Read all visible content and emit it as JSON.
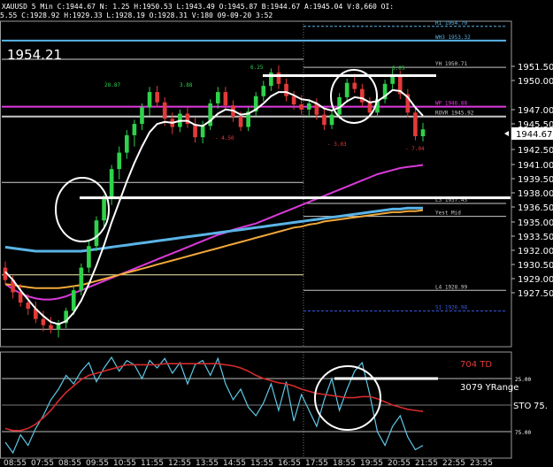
{
  "header": {
    "line1": "XAUUSD 5 Min  C:1944.67  N:  1.25  H:1950.53  L:1943.49  O:1945.87  B:1944.67  A:1945.04  V:8,660  OI:",
    "line2": "5.55  C:1928.92  H:1929.33  L:1928.19  O:1928.31  V:180  09-09-20  3:52",
    "big_price": "1954.21"
  },
  "colors": {
    "background": "#000000",
    "candle_up": "#2fd24a",
    "candle_down": "#e23a3a",
    "ema": "#ffffff",
    "pink_ma": "#d93ad9",
    "blue_ma": "#5ab4e6",
    "orange_ma": "#f2a93a",
    "magenta_level": "#e03ae0",
    "stoch_k": "#5ec8e6",
    "stoch_d": "#d42b2b"
  },
  "chart_data": [
    {
      "type": "candlestick",
      "title": "XAUUSD 5 Min",
      "y_ticks": [
        "1951.50",
        "1950.00",
        "1947.00",
        "1945.50",
        "1944.00",
        "1942.50",
        "1941.00",
        "1939.50",
        "1938.00",
        "1936.50",
        "1935.00",
        "1933.50",
        "1932.00",
        "1930.50",
        "1929.00",
        "1927.50"
      ],
      "ylim": [
        1923.5,
        1955.2
      ],
      "current_price": "1944.67",
      "levels": [
        {
          "label": "R1 1954.70",
          "value": 1954.7,
          "color": "#5ab4e6"
        },
        {
          "label": "WH3 1953.32",
          "value": 1953.32,
          "color": "#5ab4e6"
        },
        {
          "label": "YH 1950.71",
          "value": 1950.71,
          "color": "#c8c8c8"
        },
        {
          "label": "WP 1946.88",
          "value": 1946.88,
          "color": "#e03ae0"
        },
        {
          "label": "ROVR 1945.92",
          "value": 1945.92,
          "color": "#c8c8c8"
        },
        {
          "label": "L3 1937.45",
          "value": 1937.45,
          "color": "#c8c8c8"
        },
        {
          "label": "Yest Mid",
          "value": 1936.2,
          "color": "#c8c8c8"
        },
        {
          "label": "L4 1928.99",
          "value": 1928.99,
          "color": "#c8c8c8"
        },
        {
          "label": "S1 1926.98",
          "value": 1926.98,
          "color": "#3a5ae6"
        }
      ],
      "swing_labels": [
        {
          "text": "28.87",
          "color": "#2fd24a"
        },
        {
          "text": "3.88",
          "color": "#2fd24a"
        },
        {
          "text": "6.25",
          "color": "#2fd24a"
        },
        {
          "text": "6.05",
          "color": "#2fd24a"
        },
        {
          "text": "- 4.50",
          "color": "#e23a3a"
        },
        {
          "text": "- 3.03",
          "color": "#e23a3a"
        },
        {
          "text": "- 7.04",
          "color": "#e23a3a"
        }
      ],
      "candles": [
        [
          1931.2,
          1931.8,
          1929.6,
          1930.0
        ],
        [
          1930.0,
          1930.4,
          1928.2,
          1928.8
        ],
        [
          1928.8,
          1929.6,
          1927.4,
          1927.8
        ],
        [
          1927.8,
          1928.6,
          1926.6,
          1927.2
        ],
        [
          1927.2,
          1927.9,
          1925.8,
          1926.2
        ],
        [
          1926.2,
          1927.0,
          1925.0,
          1925.6
        ],
        [
          1925.6,
          1926.4,
          1924.8,
          1925.2
        ],
        [
          1925.2,
          1926.1,
          1924.4,
          1925.8
        ],
        [
          1925.8,
          1927.3,
          1925.3,
          1927.0
        ],
        [
          1927.0,
          1929.4,
          1926.6,
          1929.0
        ],
        [
          1929.0,
          1931.6,
          1928.5,
          1931.2
        ],
        [
          1931.2,
          1933.8,
          1930.7,
          1933.3
        ],
        [
          1933.3,
          1936.2,
          1932.8,
          1935.8
        ],
        [
          1935.8,
          1938.3,
          1935.2,
          1937.9
        ],
        [
          1937.9,
          1941.2,
          1937.3,
          1940.8
        ],
        [
          1940.8,
          1943.0,
          1939.8,
          1942.4
        ],
        [
          1942.4,
          1944.6,
          1941.8,
          1944.1
        ],
        [
          1944.1,
          1945.6,
          1943.0,
          1945.2
        ],
        [
          1945.2,
          1947.2,
          1944.6,
          1946.8
        ],
        [
          1946.8,
          1948.8,
          1946.0,
          1948.3
        ],
        [
          1948.3,
          1948.9,
          1946.8,
          1947.3
        ],
        [
          1947.3,
          1947.8,
          1945.0,
          1945.7
        ],
        [
          1945.7,
          1946.3,
          1944.2,
          1944.9
        ],
        [
          1944.9,
          1946.6,
          1944.4,
          1946.2
        ],
        [
          1946.2,
          1946.8,
          1944.8,
          1945.2
        ],
        [
          1945.2,
          1945.8,
          1943.4,
          1943.9
        ],
        [
          1943.9,
          1945.5,
          1943.3,
          1945.0
        ],
        [
          1945.0,
          1947.6,
          1944.6,
          1947.2
        ],
        [
          1947.2,
          1948.8,
          1946.7,
          1948.3
        ],
        [
          1948.3,
          1948.8,
          1946.6,
          1947.0
        ],
        [
          1947.0,
          1947.5,
          1945.4,
          1945.9
        ],
        [
          1945.9,
          1946.4,
          1944.5,
          1944.9
        ],
        [
          1944.9,
          1946.8,
          1944.5,
          1946.4
        ],
        [
          1946.4,
          1948.3,
          1946.0,
          1947.9
        ],
        [
          1947.9,
          1949.4,
          1947.4,
          1948.9
        ],
        [
          1948.9,
          1950.6,
          1948.4,
          1950.2
        ],
        [
          1950.2,
          1950.9,
          1948.6,
          1949.1
        ],
        [
          1949.1,
          1949.6,
          1947.4,
          1947.9
        ],
        [
          1947.9,
          1948.4,
          1946.6,
          1947.1
        ],
        [
          1947.1,
          1948.0,
          1946.1,
          1946.6
        ],
        [
          1946.6,
          1947.6,
          1945.8,
          1947.2
        ],
        [
          1947.2,
          1947.7,
          1945.6,
          1946.1
        ],
        [
          1946.1,
          1946.6,
          1944.6,
          1945.1
        ],
        [
          1945.1,
          1946.5,
          1944.7,
          1946.1
        ],
        [
          1946.1,
          1948.2,
          1945.7,
          1947.8
        ],
        [
          1947.8,
          1949.6,
          1947.3,
          1949.2
        ],
        [
          1949.2,
          1950.1,
          1948.2,
          1948.6
        ],
        [
          1948.6,
          1949.1,
          1946.8,
          1947.3
        ],
        [
          1947.3,
          1947.8,
          1945.8,
          1946.3
        ],
        [
          1946.3,
          1948.0,
          1945.9,
          1947.6
        ],
        [
          1947.6,
          1949.5,
          1947.2,
          1949.1
        ],
        [
          1949.1,
          1950.5,
          1948.6,
          1950.0
        ],
        [
          1950.0,
          1950.4,
          1947.6,
          1948.1
        ],
        [
          1948.1,
          1948.6,
          1945.8,
          1946.3
        ],
        [
          1946.3,
          1946.8,
          1943.6,
          1944.0
        ],
        [
          1944.0,
          1945.3,
          1943.5,
          1944.67
        ]
      ],
      "indicators": [
        {
          "name": "EMA",
          "color": "#ffffff",
          "values": [
            1930.8,
            1930.0,
            1929.0,
            1928.1,
            1927.2,
            1926.5,
            1925.9,
            1925.7,
            1926.0,
            1926.8,
            1928.0,
            1929.6,
            1931.4,
            1933.4,
            1935.6,
            1937.6,
            1939.6,
            1941.4,
            1943.0,
            1944.4,
            1945.2,
            1945.4,
            1945.3,
            1945.5,
            1945.5,
            1945.1,
            1945.0,
            1945.5,
            1946.2,
            1946.6,
            1946.5,
            1946.1,
            1946.2,
            1946.6,
            1947.2,
            1947.9,
            1948.3,
            1948.3,
            1948.0,
            1947.6,
            1947.5,
            1947.2,
            1946.7,
            1946.5,
            1946.8,
            1947.4,
            1947.8,
            1947.7,
            1947.3,
            1947.4,
            1947.9,
            1948.5,
            1948.4,
            1947.8,
            1946.8,
            1946.0
          ]
        },
        {
          "name": "Pink MA",
          "color": "#d93ad9",
          "values": [
            1929.6,
            1929.1,
            1928.7,
            1928.4,
            1928.2,
            1928.1,
            1928.1,
            1928.2,
            1928.4,
            1928.7,
            1929.0,
            1929.3,
            1929.6,
            1929.9,
            1930.2,
            1930.5,
            1930.8,
            1931.1,
            1931.4,
            1931.7,
            1932.0,
            1932.3,
            1932.6,
            1932.9,
            1933.2,
            1933.5,
            1933.8,
            1934.1,
            1934.4,
            1934.6,
            1934.9,
            1935.1,
            1935.3,
            1935.5,
            1935.8,
            1936.1,
            1936.4,
            1936.7,
            1937.0,
            1937.3,
            1937.6,
            1937.9,
            1938.2,
            1938.5,
            1938.8,
            1939.1,
            1939.4,
            1939.7,
            1940.0,
            1940.3,
            1940.5,
            1940.7,
            1940.9,
            1941.0,
            1941.1,
            1941.2
          ]
        },
        {
          "name": "Blue MA",
          "color": "#5ab4e6",
          "values": [
            1933.2,
            1933.1,
            1933.0,
            1932.9,
            1932.8,
            1932.8,
            1932.8,
            1932.8,
            1932.8,
            1932.8,
            1932.8,
            1932.9,
            1933.0,
            1933.1,
            1933.2,
            1933.3,
            1933.4,
            1933.5,
            1933.6,
            1933.7,
            1933.8,
            1933.9,
            1934.0,
            1934.1,
            1934.2,
            1934.3,
            1934.4,
            1934.5,
            1934.6,
            1934.7,
            1934.8,
            1934.9,
            1935.0,
            1935.1,
            1935.2,
            1935.3,
            1935.4,
            1935.5,
            1935.6,
            1935.7,
            1935.8,
            1935.9,
            1936.0,
            1936.1,
            1936.2,
            1936.3,
            1936.4,
            1936.5,
            1936.6,
            1936.7,
            1936.8,
            1936.9,
            1936.9,
            1937.0,
            1937.0,
            1937.0
          ]
        },
        {
          "name": "Orange MA",
          "color": "#f2a93a",
          "values": [
            1929.6,
            1929.5,
            1929.4,
            1929.3,
            1929.2,
            1929.2,
            1929.2,
            1929.2,
            1929.3,
            1929.4,
            1929.5,
            1929.7,
            1929.9,
            1930.1,
            1930.3,
            1930.5,
            1930.7,
            1930.9,
            1931.1,
            1931.3,
            1931.5,
            1931.7,
            1931.9,
            1932.1,
            1932.3,
            1932.5,
            1932.7,
            1932.9,
            1933.1,
            1933.3,
            1933.5,
            1933.7,
            1933.9,
            1934.1,
            1934.3,
            1934.5,
            1934.7,
            1934.9,
            1935.1,
            1935.2,
            1935.4,
            1935.5,
            1935.7,
            1935.8,
            1935.9,
            1936.0,
            1936.1,
            1936.2,
            1936.3,
            1936.4,
            1936.5,
            1936.6,
            1936.6,
            1936.7,
            1936.7,
            1936.8
          ]
        }
      ]
    },
    {
      "type": "line",
      "title": "",
      "labels": [
        "704 TD",
        "3079 YRange",
        "STO"
      ],
      "label_colors": [
        "#e23a3a",
        "#ffffff",
        "#ffffff"
      ],
      "right_value": "75.",
      "y_ticks": [
        "25.00",
        "75.00"
      ],
      "ylim": [
        100,
        0
      ],
      "x_ticks": [
        "08:55",
        "07:55",
        "08:55",
        "09:55",
        "10:55",
        "11:55",
        "12:55",
        "13:55",
        "14:55",
        "15:55",
        "16:55",
        "17:55",
        "18:55",
        "19:55",
        "20:55",
        "21:55",
        "22:55",
        "23:55"
      ],
      "series": [
        {
          "name": "%K",
          "color": "#5ec8e6",
          "values": [
            85,
            95,
            78,
            88,
            72,
            60,
            45,
            35,
            22,
            30,
            18,
            10,
            28,
            15,
            5,
            18,
            8,
            12,
            25,
            8,
            15,
            6,
            20,
            10,
            30,
            12,
            8,
            22,
            6,
            30,
            45,
            35,
            52,
            60,
            48,
            30,
            55,
            28,
            65,
            40,
            55,
            70,
            45,
            25,
            55,
            35,
            18,
            10,
            40,
            75,
            88,
            70,
            60,
            80,
            92,
            88
          ]
        },
        {
          "name": "%D",
          "color": "#d42b2b",
          "values": [
            72,
            74,
            74,
            72,
            68,
            62,
            55,
            46,
            38,
            32,
            26,
            22,
            20,
            18,
            16,
            14,
            12,
            12,
            12,
            12,
            12,
            11,
            11,
            11,
            11,
            11,
            11,
            11,
            11,
            12,
            13,
            15,
            18,
            22,
            25,
            27,
            29,
            30,
            32,
            35,
            37,
            39,
            40,
            41,
            42,
            43,
            43,
            42,
            42,
            44,
            47,
            50,
            52,
            54,
            55,
            56
          ]
        }
      ]
    }
  ]
}
